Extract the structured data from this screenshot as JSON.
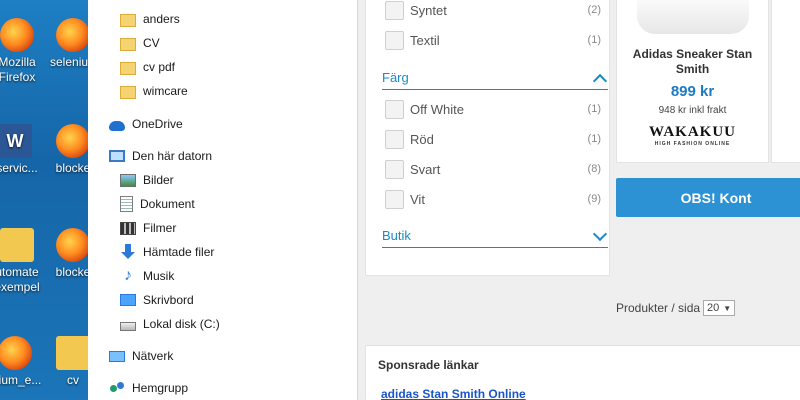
{
  "desktop": {
    "icons": [
      {
        "label_line1": "Mozilla",
        "label_line2": "Firefox",
        "icon": "firefox-icon"
      },
      {
        "label_line1": "selenium",
        "label_line2": "",
        "icon": "firefox-icon"
      },
      {
        "label_line1": "-servic...",
        "label_line2": "",
        "icon": "word-icon"
      },
      {
        "label_line1": "blocke",
        "label_line2": "",
        "icon": "firefox-icon"
      },
      {
        "label_line1": "utomate",
        "label_line2": "exempel",
        "icon": "folder-icon"
      },
      {
        "label_line1": "blocke",
        "label_line2": "",
        "icon": "firefox-icon"
      },
      {
        "label_line1": "nium_e...",
        "label_line2": "",
        "icon": "firefox-icon"
      },
      {
        "label_line1": "cv",
        "label_line2": "",
        "icon": "folder-icon"
      }
    ]
  },
  "explorer": {
    "folders": [
      "anders",
      "CV",
      "cv pdf",
      "wimcare"
    ],
    "onedrive": "OneDrive",
    "this_pc": "Den här datorn",
    "pc_items": [
      "Bilder",
      "Dokument",
      "Filmer",
      "Hämtade filer",
      "Musik",
      "Skrivbord",
      "Lokal disk (C:)"
    ],
    "network": "Nätverk",
    "homegroup": "Hemgrupp"
  },
  "filters": {
    "material_items": [
      {
        "label": "Syntet",
        "count": "(2)"
      },
      {
        "label": "Textil",
        "count": "(1)"
      }
    ],
    "color_heading": "Färg",
    "color_items": [
      {
        "label": "Off White",
        "count": "(1)"
      },
      {
        "label": "Röd",
        "count": "(1)"
      },
      {
        "label": "Svart",
        "count": "(8)"
      },
      {
        "label": "Vit",
        "count": "(9)"
      }
    ],
    "store_heading": "Butik"
  },
  "product": {
    "name_line1": "Adidas Sneaker Stan",
    "name_line2": "Smith",
    "price": "899 kr",
    "shipping": "948 kr inkl frakt",
    "store_logo": "WAKAKUU",
    "store_logo_sub": "HIGH FASHION ONLINE"
  },
  "obs_button": "OBS! Kont",
  "pagination": {
    "label": "Produkter / sida",
    "value": "20"
  },
  "sponsored": {
    "title": "Sponsrade länkar",
    "link": "adidas Stan Smith Online"
  },
  "colors": {
    "accent": "#1a8ac6",
    "button": "#2d92d3",
    "price": "#1a7ac4"
  }
}
